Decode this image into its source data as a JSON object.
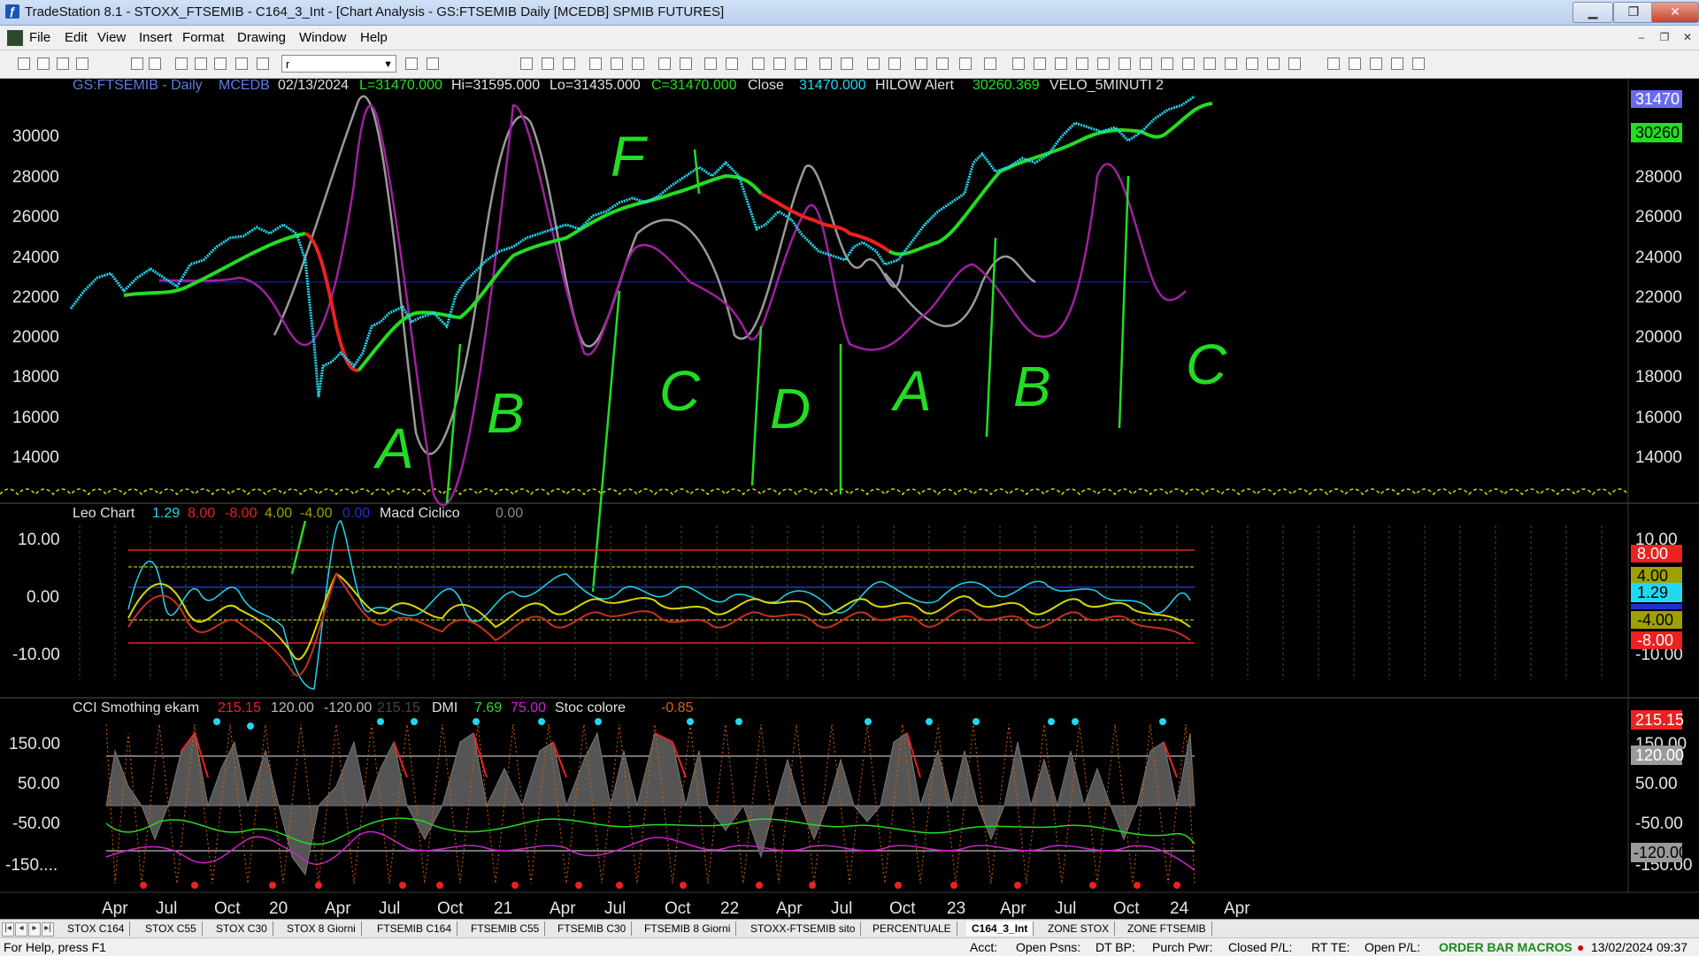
{
  "window": {
    "title": "TradeStation 8.1 - STOXX_FTSEMIB - C164_3_Int - [Chart Analysis - GS:FTSEMIB  Daily  [MCEDB] SPMIB FUTURES]",
    "minimize": "▁",
    "maximize": "❐",
    "close": "✕"
  },
  "menu": {
    "items": [
      "File",
      "Edit",
      "View",
      "Insert",
      "Format",
      "Drawing",
      "Window",
      "Help"
    ],
    "mdi": [
      "‒",
      "❐",
      "✕"
    ]
  },
  "toolbar": {
    "symbol_value": "r"
  },
  "chart": {
    "header": {
      "symbol": "GS:FTSEMIB - Daily",
      "source": "MCEDB",
      "date": "02/13/2024",
      "last": "L=31470.000",
      "high": "Hi=31595.000",
      "low": "Lo=31435.000",
      "close_val": "C=31470.000",
      "close_label": "Close",
      "close_num": "31470.000",
      "hilow_label": "HILOW Alert",
      "hilow_val": "30260.369",
      "velo_label": "VELO_5MINUTI 2"
    },
    "price_axis": [
      "30000",
      "28000",
      "26000",
      "24000",
      "22000",
      "20000",
      "18000",
      "16000",
      "14000"
    ],
    "price_tags": {
      "top": "31470",
      "green": "30260"
    },
    "annotations": [
      "A",
      "B",
      "C",
      "D",
      "A",
      "B",
      "C",
      "F"
    ],
    "leo": {
      "title": "Leo Chart",
      "v1": "1.29",
      "v2": "8.00",
      "v3": "-8.00",
      "v4": "4.00",
      "v5": "-4.00",
      "v6": "0.00",
      "macd_label": "Macd Ciclico",
      "macd_val": "0.00",
      "axis": [
        "10.00",
        "0.00",
        "-10.00"
      ],
      "tags": [
        "8.00",
        "4.00",
        "1.29",
        "-4.00",
        "-8.00"
      ]
    },
    "cci": {
      "title": "CCI Smothing ekam",
      "v1": "215.15",
      "v2": "120.00",
      "v3": "-120.00",
      "v4": "215.15",
      "dmi_label": "DMI",
      "dmi1": "7.69",
      "dmi2": "75.00",
      "stoc_label": "Stoc colore",
      "stoc_val": "-0.85",
      "axis": [
        "150.00",
        "50.00",
        "-50.00",
        "-150...."
      ],
      "tags": [
        "215.15",
        "150.00",
        "120.00",
        "50.00",
        "-50.00",
        "-120.00",
        "-150.00"
      ]
    },
    "time_axis": [
      "Apr",
      "Jul",
      "Oct",
      "20",
      "Apr",
      "Jul",
      "Oct",
      "21",
      "Apr",
      "Jul",
      "Oct",
      "22",
      "Apr",
      "Jul",
      "Oct",
      "23",
      "Apr",
      "Jul",
      "Oct",
      "24",
      "Apr"
    ]
  },
  "tabs": [
    "STOX C164",
    "STOX C55",
    "STOX  C30",
    "STOX  8 Giorni",
    "FTSEMIB C164",
    "FTSEMIB C55",
    "FTSEMIB C30",
    "FTSEMIB  8 Giorni",
    "STOXX-FTSEMIB sito",
    "PERCENTUALE",
    "C164_3_Int",
    "ZONE STOX",
    "ZONE FTSEMIB"
  ],
  "status": {
    "help": "For Help, press F1",
    "acct": "Acct:",
    "open_psns": "Open Psns:",
    "dt_bp": "DT BP:",
    "purch_pwr": "Purch Pwr:",
    "closed_pl": "Closed P/L:",
    "rt_te": "RT TE:",
    "open_pl": "Open P/L:",
    "macros": "ORDER BAR  MACROS",
    "datetime": "13/02/2024 09:37"
  }
}
